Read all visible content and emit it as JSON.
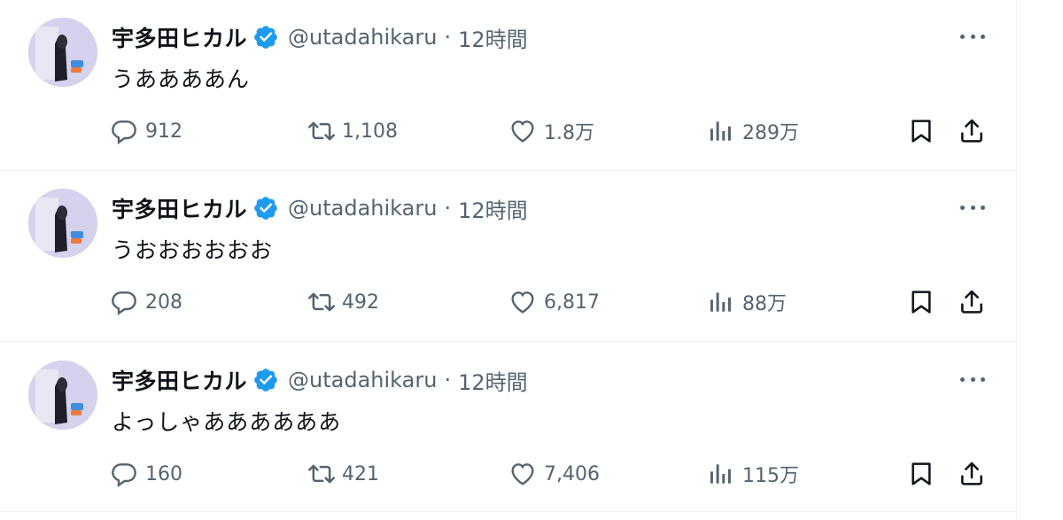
{
  "colors": {
    "text": "#0f1419",
    "secondary": "#536471",
    "verified": "#1d9bf0",
    "divider": "#eff3f4"
  },
  "icons": [
    "reply-icon",
    "retweet-icon",
    "like-icon",
    "views-icon",
    "bookmark-icon",
    "share-icon",
    "more-icon",
    "verified-badge-icon"
  ],
  "tweets": [
    {
      "author": {
        "name": "宇多田ヒカル",
        "handle": "@utadahikaru"
      },
      "separator": "·",
      "time": "12時間",
      "text": "うああああん",
      "stats": {
        "replies": "912",
        "retweets": "1,108",
        "likes": "1.8万",
        "views": "289万"
      }
    },
    {
      "author": {
        "name": "宇多田ヒカル",
        "handle": "@utadahikaru"
      },
      "separator": "·",
      "time": "12時間",
      "text": "うおおおおおお",
      "stats": {
        "replies": "208",
        "retweets": "492",
        "likes": "6,817",
        "views": "88万"
      }
    },
    {
      "author": {
        "name": "宇多田ヒカル",
        "handle": "@utadahikaru"
      },
      "separator": "·",
      "time": "12時間",
      "text": "よっしゃああああああ",
      "stats": {
        "replies": "160",
        "retweets": "421",
        "likes": "7,406",
        "views": "115万"
      }
    }
  ]
}
